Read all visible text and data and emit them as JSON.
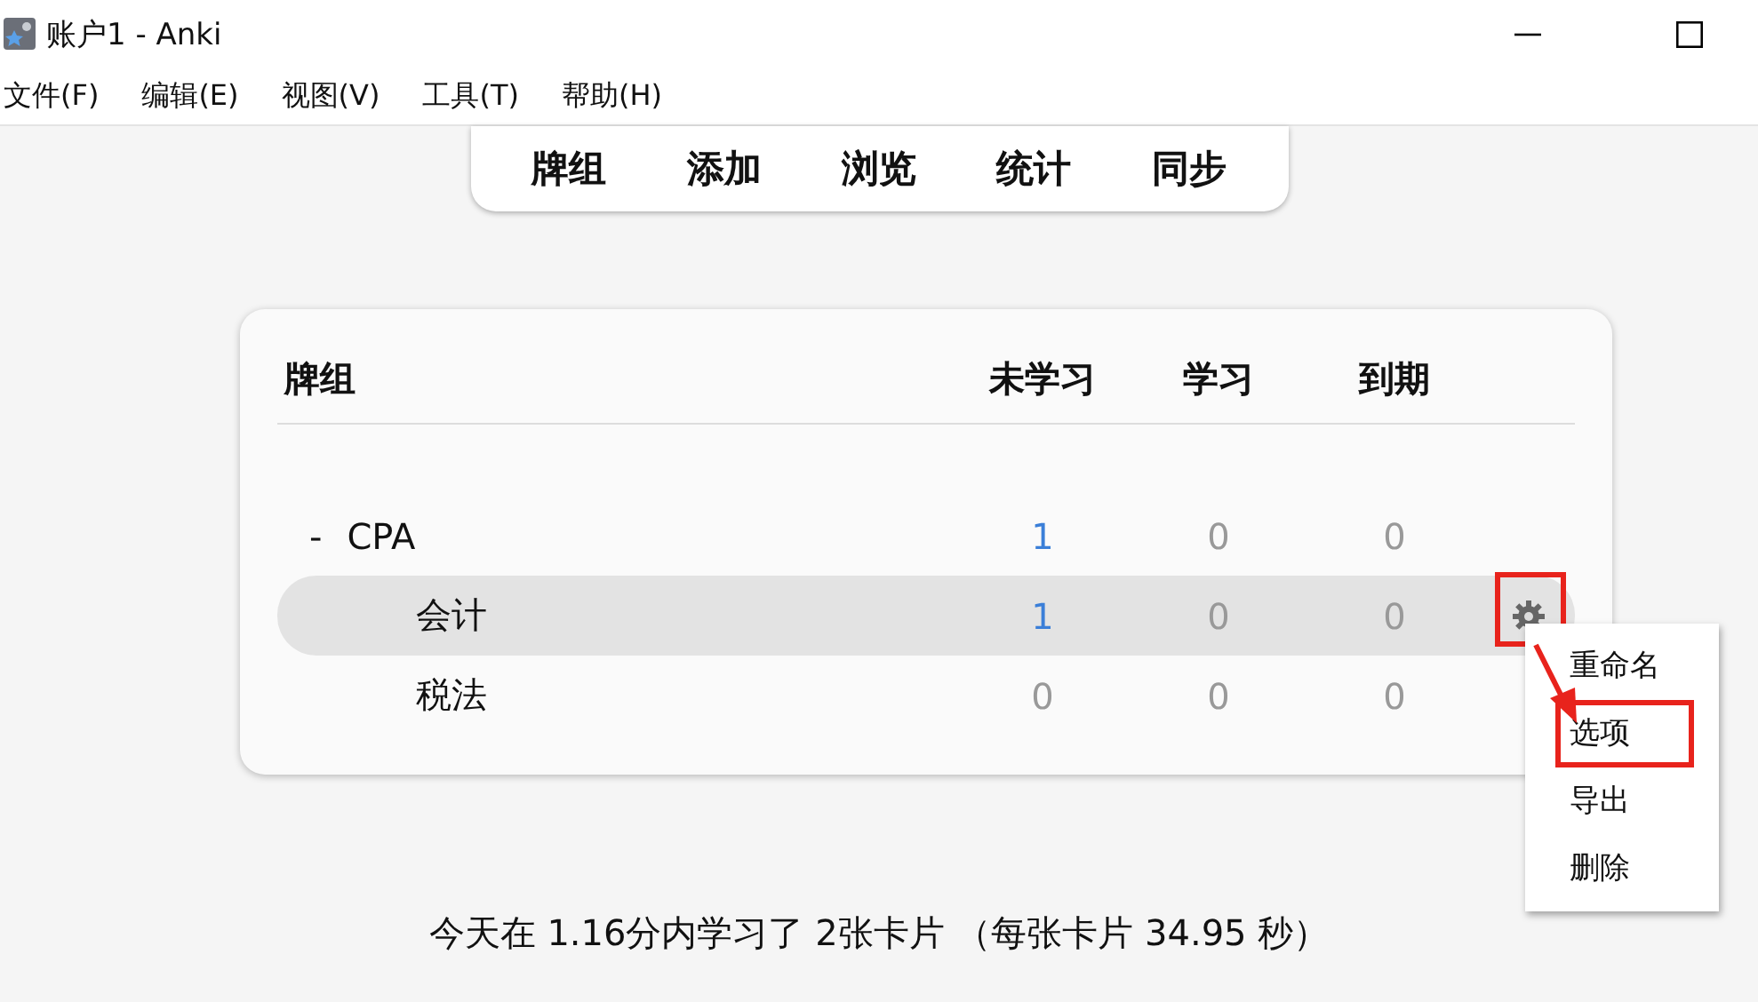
{
  "window": {
    "title": "账户1 - Anki"
  },
  "menu_bar": [
    "文件(F)",
    "编辑(E)",
    "视图(V)",
    "工具(T)",
    "帮助(H)"
  ],
  "toolbar": [
    "牌组",
    "添加",
    "浏览",
    "统计",
    "同步"
  ],
  "deck_table": {
    "columns": [
      "牌组",
      "未学习",
      "学习",
      "到期"
    ],
    "decks": [
      {
        "toggle": "-",
        "name": "CPA",
        "selected": false,
        "counts": [
          {
            "text": "1",
            "highlighted": true
          },
          {
            "text": "0",
            "highlighted": false
          },
          {
            "text": "0",
            "highlighted": false
          }
        ],
        "children": [
          {
            "name": "会计",
            "selected": true,
            "annotated": true,
            "counts": [
              {
                "text": "1",
                "highlighted": true
              },
              {
                "text": "0",
                "highlighted": false
              },
              {
                "text": "0",
                "highlighted": false
              }
            ]
          },
          {
            "name": "税法",
            "selected": false,
            "annotated": false,
            "counts": [
              {
                "text": "0",
                "highlighted": false
              },
              {
                "text": "0",
                "highlighted": false
              },
              {
                "text": "0",
                "highlighted": false
              }
            ]
          }
        ]
      }
    ]
  },
  "context_menu": [
    {
      "label": "重命名",
      "annotated": false
    },
    {
      "label": "选项",
      "annotated": true
    },
    {
      "label": "导出",
      "annotated": false
    },
    {
      "label": "删除",
      "annotated": false
    }
  ],
  "footer": "今天在 1.16分内学习了 2张卡片 （每张卡片 34.95 秒）"
}
